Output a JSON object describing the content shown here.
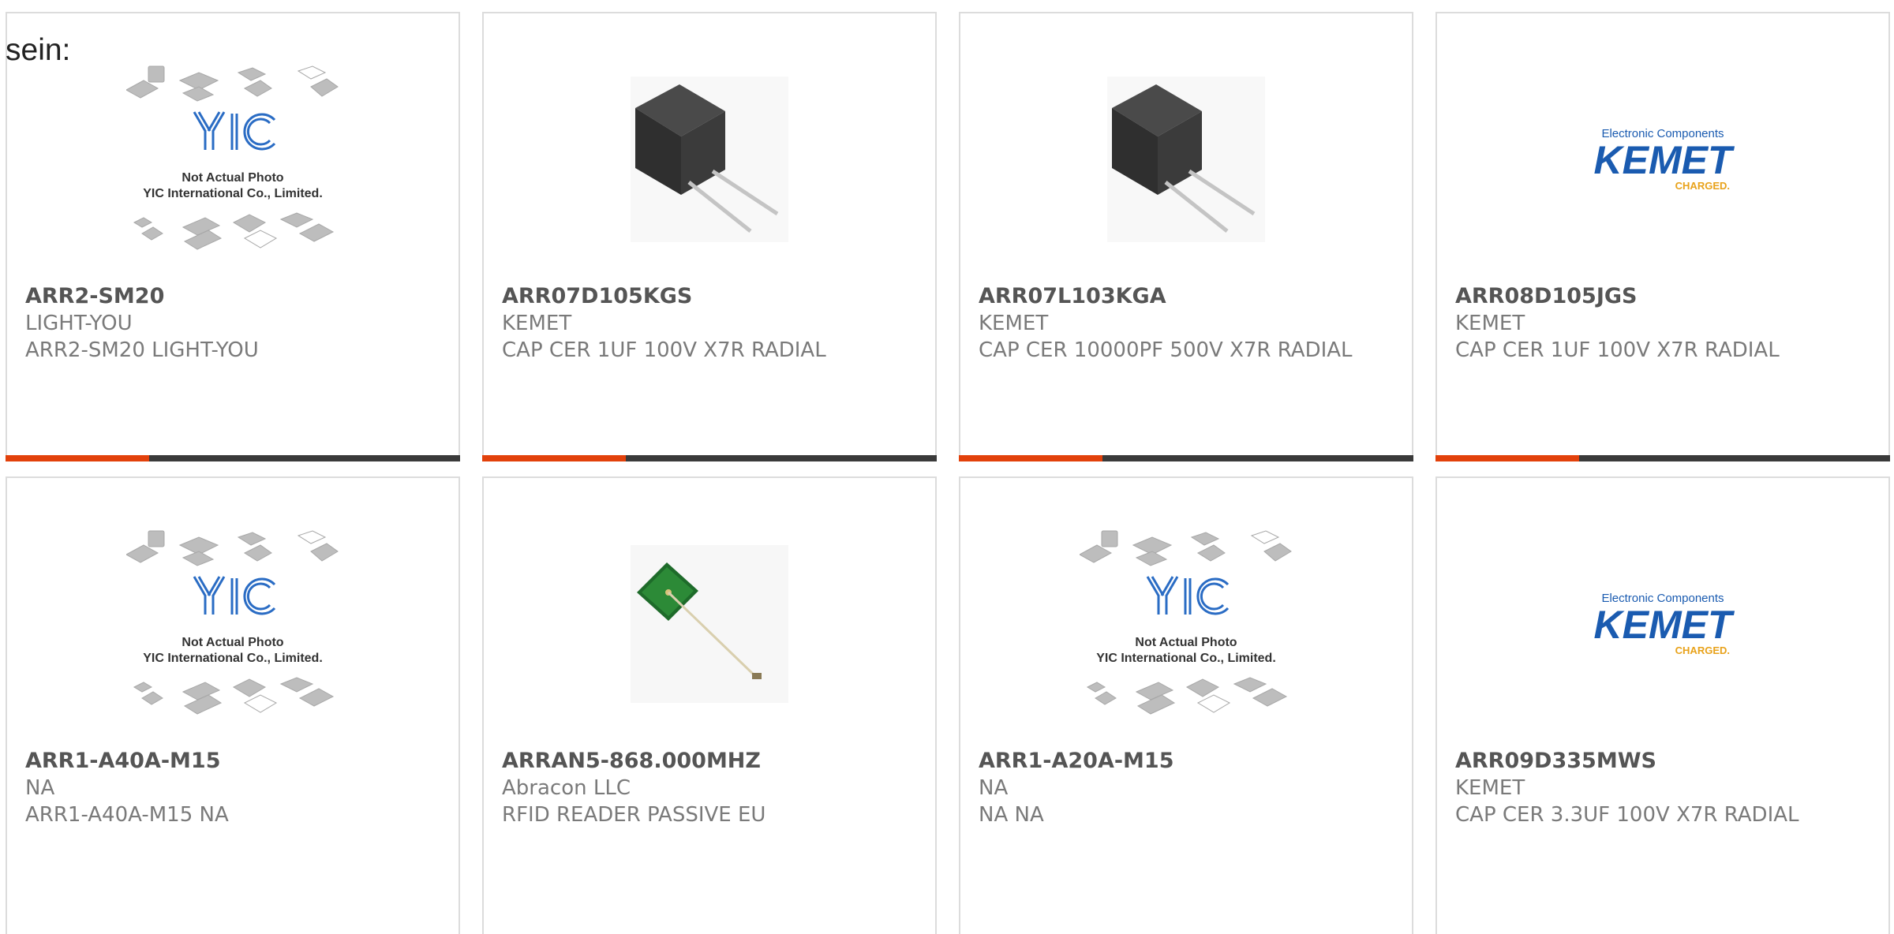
{
  "heading": "sein:",
  "placeholder_image": {
    "line1": "Not Actual Photo",
    "line2": "YIC International Co., Limited.",
    "logo": "YIC"
  },
  "kemet_logo": {
    "tagline": "Electronic Components",
    "name": "KEMET",
    "slogan": "CHARGED."
  },
  "products": [
    {
      "part": "ARR2-SM20",
      "manufacturer": "LIGHT-YOU",
      "description": "ARR2-SM20 LIGHT-YOU",
      "image": "yic-placeholder"
    },
    {
      "part": "ARR07D105KGS",
      "manufacturer": "KEMET",
      "description": "CAP CER 1UF 100V X7R RADIAL",
      "image": "radial-capacitor"
    },
    {
      "part": "ARR07L103KGA",
      "manufacturer": "KEMET",
      "description": "CAP CER 10000PF 500V X7R RADIAL",
      "image": "radial-capacitor"
    },
    {
      "part": "ARR08D105JGS",
      "manufacturer": "KEMET",
      "description": "CAP CER 1UF 100V X7R RADIAL",
      "image": "kemet-logo"
    },
    {
      "part": "ARR1-A40A-M15",
      "manufacturer": "NA",
      "description": "ARR1-A40A-M15 NA",
      "image": "yic-placeholder"
    },
    {
      "part": "ARRAN5-868.000MHZ",
      "manufacturer": "Abracon LLC",
      "description": "RFID READER PASSIVE EU",
      "image": "rfid-antenna"
    },
    {
      "part": "ARR1-A20A-M15",
      "manufacturer": "NA",
      "description": "NA NA",
      "image": "yic-placeholder"
    },
    {
      "part": "ARR09D335MWS",
      "manufacturer": "KEMET",
      "description": "CAP CER 3.3UF 100V X7R RADIAL",
      "image": "kemet-logo"
    }
  ],
  "colors": {
    "accent": "#e2410b",
    "bar": "#3a3a3a",
    "border": "#dcdcdc"
  }
}
